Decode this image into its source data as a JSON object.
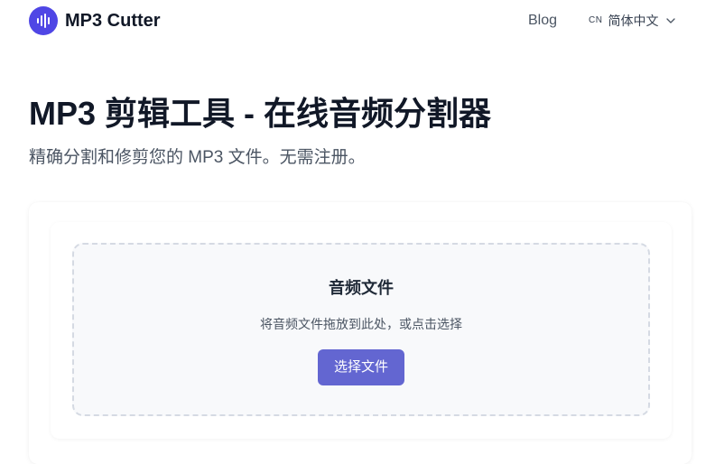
{
  "header": {
    "brand_name": "MP3 Cutter",
    "logo_icon": "waveform-icon",
    "nav": {
      "blog_label": "Blog"
    },
    "language": {
      "code": "CN",
      "name": "简体中文",
      "chevron_icon": "chevron-down-icon"
    }
  },
  "hero": {
    "title": "MP3 剪辑工具 - 在线音频分割器",
    "subtitle": "精确分割和修剪您的 MP3 文件。无需注册。"
  },
  "upload": {
    "title": "音频文件",
    "hint": "将音频文件拖放到此处，或点击选择",
    "button_label": "选择文件"
  },
  "colors": {
    "brand": "#4f46e5",
    "button": "#6366d1",
    "dropzone_border": "#d5dae3",
    "dropzone_bg": "#f8f9fb"
  }
}
